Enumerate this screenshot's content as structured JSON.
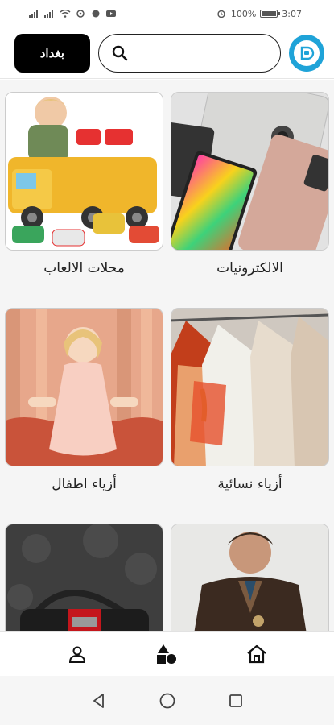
{
  "status_bar": {
    "battery": "100%",
    "time": "3:07"
  },
  "header": {
    "city_label": "بغداد",
    "search_placeholder": "",
    "logo_icon": "store-logo-icon"
  },
  "categories": [
    {
      "label": "الالكترونيات",
      "image": "smartphones-photo"
    },
    {
      "label": "محلات الالعاب",
      "image": "toy-truck-photo"
    },
    {
      "label": "أزياء نسائية",
      "image": "clothes-rack-photo"
    },
    {
      "label": "أزياء اطفال",
      "image": "girl-dress-photo"
    },
    {
      "label": "",
      "image": "man-jacket-photo"
    },
    {
      "label": "",
      "image": "handbag-photo"
    }
  ],
  "bottom_nav": {
    "items": [
      "home-icon",
      "categories-icon",
      "profile-icon"
    ]
  },
  "colors": {
    "accent": "#1fa3d8",
    "button_bg": "#000000"
  }
}
